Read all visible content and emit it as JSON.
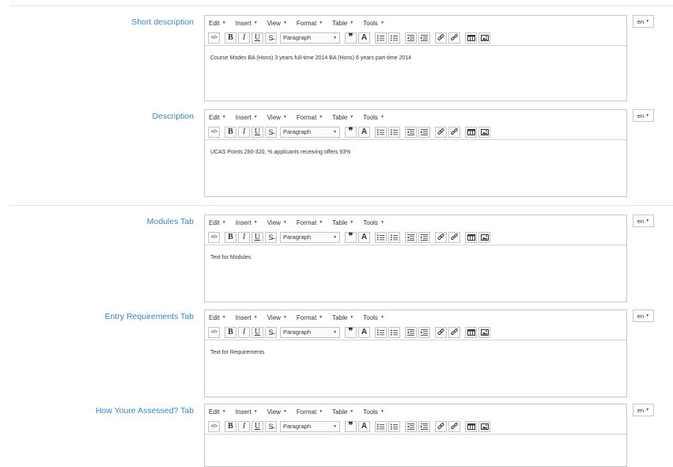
{
  "menus": [
    "Edit",
    "Insert",
    "View",
    "Format",
    "Table",
    "Tools"
  ],
  "block_format": "Paragraph",
  "language": "en",
  "toolbar_icons": [
    "source-code-icon",
    "bold-icon",
    "italic-icon",
    "underline-icon",
    "strikethrough-icon",
    "blockquote-icon",
    "font-icon",
    "bullet-list-icon",
    "numbered-list-icon",
    "outdent-icon",
    "indent-icon",
    "link-icon",
    "unlink-icon",
    "table-icon",
    "image-icon"
  ],
  "fields": [
    {
      "label": "Short description",
      "content": "Course Modes BA (Hons) 3 years full-time 2014 BA (Hons) 6 years part-time 2014"
    },
    {
      "label": "Description",
      "content": "UCAS Points 280-320, % applicants receiving offers 93%"
    },
    {
      "label": "Modules Tab",
      "content": "Text for Modules"
    },
    {
      "label": "Entry Requirements Tab",
      "content": "Text for Requirements"
    },
    {
      "label": "How Youre Assessed? Tab",
      "content": ""
    }
  ]
}
